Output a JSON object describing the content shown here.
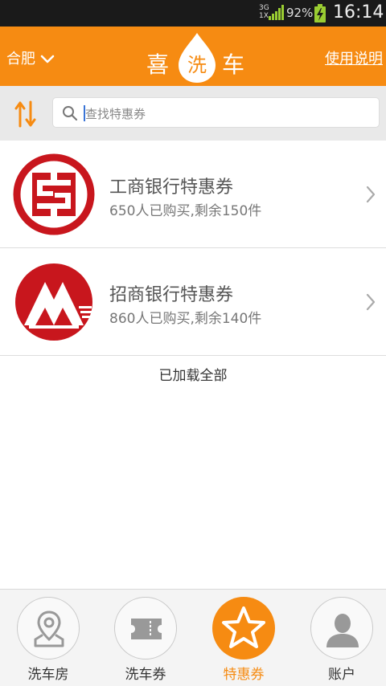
{
  "status_bar": {
    "network_top": "3G",
    "network_bottom": "1X",
    "battery_percent": "92%",
    "time": "16:14"
  },
  "header": {
    "city": "合肥",
    "logo_left": "喜",
    "logo_mid": "洗",
    "logo_right": "车",
    "help_link": "使用说明"
  },
  "search": {
    "placeholder": "查找特惠券",
    "value": ""
  },
  "coupons": [
    {
      "title": "工商银行特惠券",
      "subtitle": "650人已购买,剩余150件",
      "bank_icon": "icbc-logo",
      "brand_color": "#c8161d"
    },
    {
      "title": "招商银行特惠券",
      "subtitle": "860人已购买,剩余140件",
      "bank_icon": "cmb-logo",
      "brand_color": "#c8161d"
    }
  ],
  "list_footer": "已加载全部",
  "bottom_nav": [
    {
      "label": "洗车房",
      "icon": "map-pin-icon",
      "active": false
    },
    {
      "label": "洗车券",
      "icon": "ticket-icon",
      "active": false
    },
    {
      "label": "特惠券",
      "icon": "star-icon",
      "active": true
    },
    {
      "label": "账户",
      "icon": "user-icon",
      "active": false
    }
  ],
  "colors": {
    "accent": "#f68b12",
    "status_bar": "#1a1a1a",
    "search_bar_bg": "#e9e9e9"
  }
}
